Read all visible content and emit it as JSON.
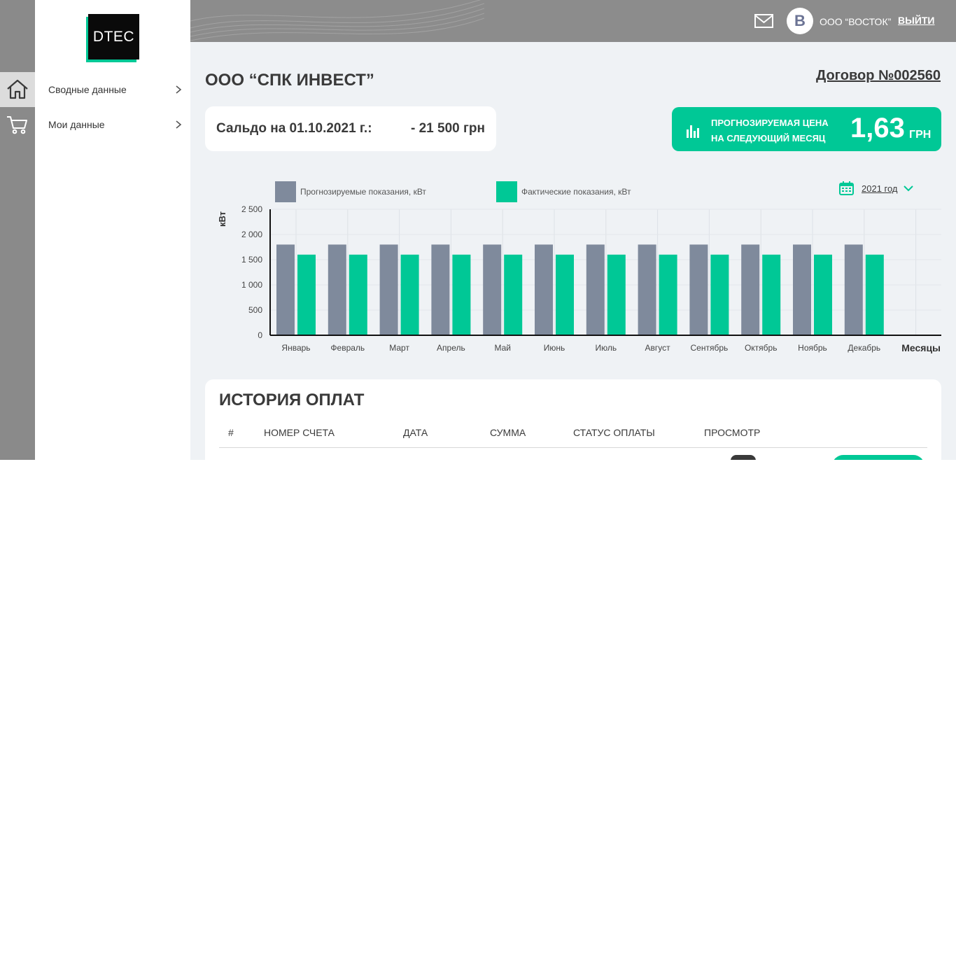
{
  "sidebar": {
    "logo_text": "DTEC",
    "items": [
      {
        "label": "Сводные данные",
        "icon": "home-icon"
      },
      {
        "label": "Мои данные",
        "icon": "cart-icon"
      }
    ]
  },
  "header": {
    "avatar_letter": "В",
    "user_name": "ООО “ВОСТОК”",
    "logout_label": "ВЫЙТИ"
  },
  "main": {
    "company_title": "ООО “СПК ИНВЕСТ”",
    "contract_label": "Договор №002560",
    "saldo_label": "Сальдо на 01.10.2021 г.:",
    "saldo_value": "- 21 500 грн",
    "forecast": {
      "label_line1": "ПРОГНОЗИРУЕМАЯ ЦЕНА",
      "label_line2": "НА СЛЕДУЮЩИЙ МЕСЯЦ",
      "value": "1,63",
      "currency": "ГРН"
    },
    "year_select": "2021 год"
  },
  "colors": {
    "accent": "#00c896",
    "forecast_bar": "#7f8a9c",
    "header": "#8c8c8c"
  },
  "chart_data": {
    "type": "bar",
    "categories": [
      "Январь",
      "Февраль",
      "Март",
      "Апрель",
      "Май",
      "Июнь",
      "Июль",
      "Август",
      "Сентябрь",
      "Октябрь",
      "Ноябрь",
      "Декабрь"
    ],
    "series": [
      {
        "name": "Прогнозируемые показания, кВт",
        "color": "#7f8a9c",
        "values": [
          1800,
          1800,
          1800,
          1800,
          1800,
          1800,
          1800,
          1800,
          1800,
          1800,
          1800,
          1800
        ]
      },
      {
        "name": "Фактические показания, кВт",
        "color": "#00c896",
        "values": [
          1600,
          1600,
          1600,
          1600,
          1600,
          1600,
          1600,
          1600,
          1600,
          1600,
          1600,
          1600
        ]
      }
    ],
    "ylabel": "кВт",
    "xlabel": "Месяцы",
    "ylim": [
      0,
      2500
    ],
    "yticks": [
      0,
      500,
      1000,
      1500,
      2000,
      2500
    ],
    "ytick_labels": [
      "0",
      "500",
      "1 000",
      "1 500",
      "2 000",
      "2 500"
    ],
    "grid": true,
    "legend": "top-left"
  },
  "history": {
    "title": "ИСТОРИЯ ОПЛАТ",
    "columns": [
      "#",
      "НОМЕР СЧЕТА",
      "ДАТА",
      "СУММА",
      "СТАТУС ОПЛАТЫ",
      "ПРОСМОТР"
    ]
  }
}
